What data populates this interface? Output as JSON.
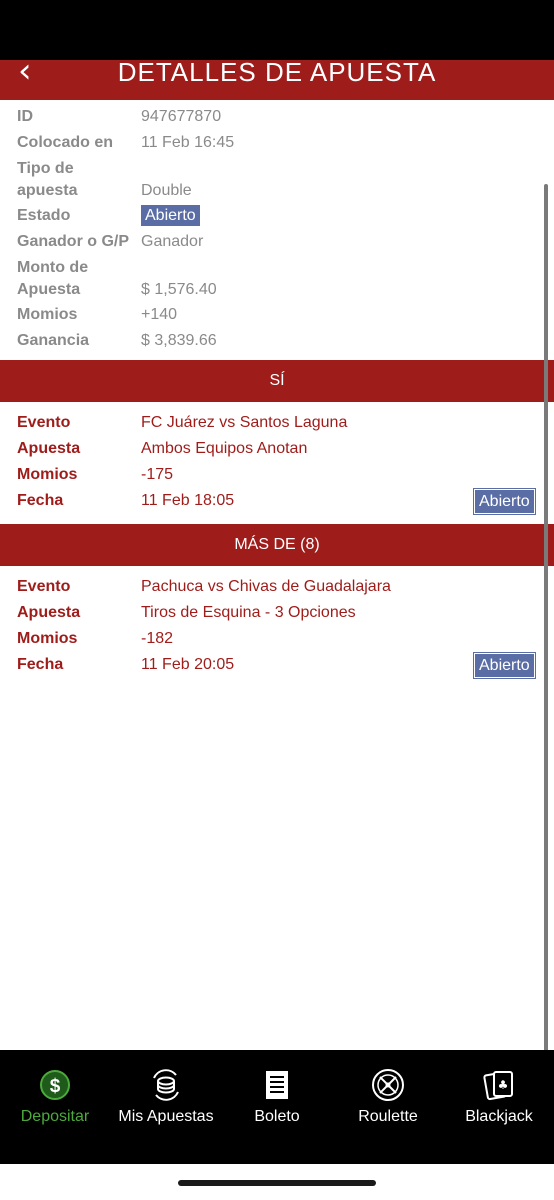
{
  "header": {
    "title": "DETALLES DE APUESTA",
    "back_icon": "chevron-left-icon"
  },
  "details": {
    "id": {
      "label": "ID",
      "value": "947677870"
    },
    "placed": {
      "label": "Colocado en",
      "value": "11 Feb 16:45"
    },
    "bet_type": {
      "label_line1": "Tipo de",
      "label_line2": "apuesta",
      "value": "Double"
    },
    "status": {
      "label": "Estado",
      "value": "Abierto"
    },
    "winner": {
      "label": "Ganador o G/P",
      "value": "Ganador"
    },
    "amount": {
      "label_line1": "Monto de",
      "label_line2": "Apuesta",
      "value": "$ 1,576.40"
    },
    "odds": {
      "label": "Momios",
      "value": "+140"
    },
    "profit": {
      "label": "Ganancia",
      "value": "$ 3,839.66"
    }
  },
  "legs": [
    {
      "section_title": "SÍ",
      "event_label": "Evento",
      "event": "FC Juárez vs Santos Laguna",
      "bet_label": "Apuesta",
      "bet": "Ambos Equipos Anotan",
      "odds_label": "Momios",
      "odds": "-175",
      "date_label": "Fecha",
      "date": "11 Feb 18:05",
      "status": "Abierto"
    },
    {
      "section_title": "MÁS DE (8)",
      "event_label": "Evento",
      "event": "Pachuca vs Chivas de Guadalajara",
      "bet_label": "Apuesta",
      "bet": "Tiros de Esquina - 3 Opciones",
      "odds_label": "Momios",
      "odds": "-182",
      "date_label": "Fecha",
      "date": "11 Feb 20:05",
      "status": "Abierto"
    }
  ],
  "tabs": [
    {
      "label": "Depositar",
      "icon": "dollar-icon",
      "active": true
    },
    {
      "label": "Mis Apuestas",
      "icon": "coins-icon",
      "active": false
    },
    {
      "label": "Boleto",
      "icon": "ticket-icon",
      "active": false
    },
    {
      "label": "Roulette",
      "icon": "roulette-icon",
      "active": false
    },
    {
      "label": "Blackjack",
      "icon": "cards-icon",
      "active": false
    }
  ],
  "colors": {
    "brand": "#9e1c1a",
    "badge": "#5a6ea5",
    "active_tab": "#4caa3c",
    "muted": "#8a8a8a"
  }
}
